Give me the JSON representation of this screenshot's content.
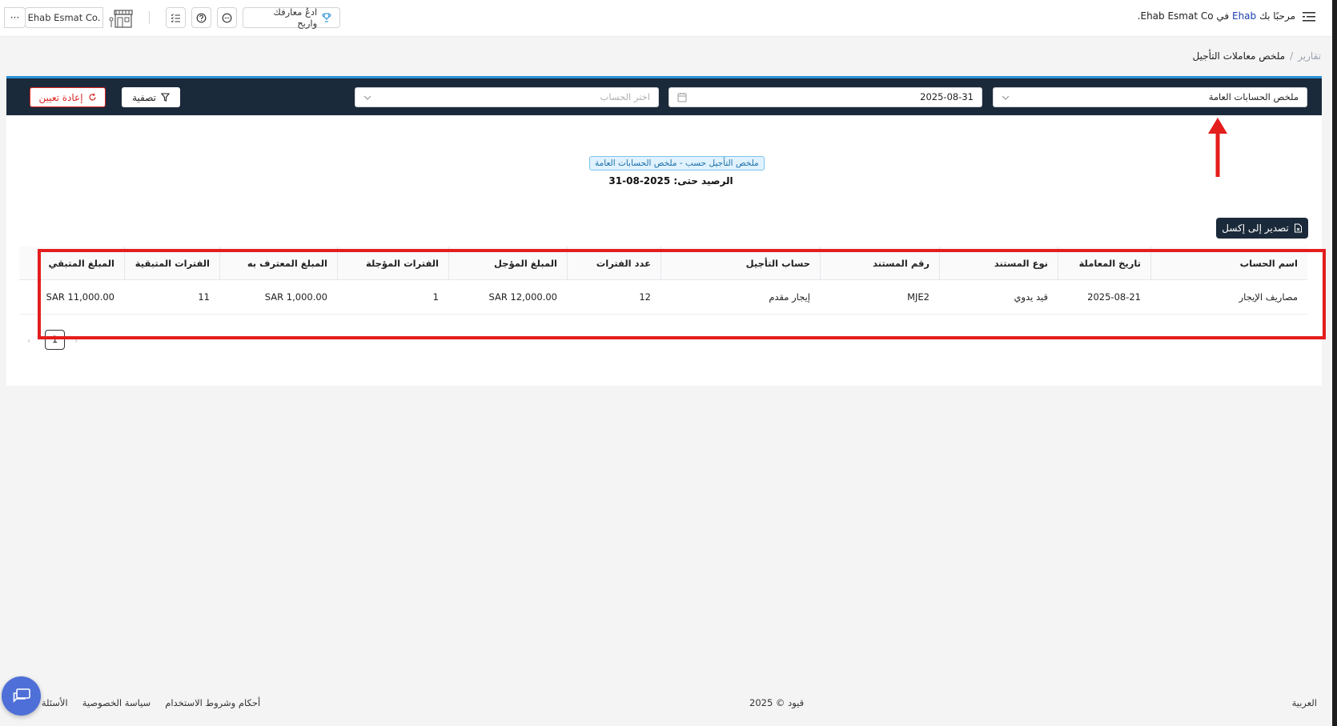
{
  "header": {
    "welcome_prefix": "مرحبًا بك",
    "user_name": "Ehab",
    "welcome_mid": "في",
    "company_name": "Ehab Esmat Co.",
    "learn_button": "ادعُ معارفك واربح",
    "company_switch": "Ehab Esmat Co.",
    "more_label": "···"
  },
  "breadcrumb": {
    "root": "تقارير",
    "separator": "/",
    "current": "ملخص معاملات التأجيل"
  },
  "filters": {
    "report_type": "ملخص الحسابات العامة",
    "date": "2025-08-31",
    "account_placeholder": "اختر الحساب",
    "filter_button": "تصفية",
    "reset_button": "إعادة تعيين"
  },
  "report": {
    "tag": "ملخص التأجيل حسب - ملخص الحسابات العامة",
    "balance_label": "الرصيد حتى:",
    "balance_date": "2025-08-31",
    "export_button": "تصدير إلى إكسل"
  },
  "table": {
    "columns": [
      "اسم الحساب",
      "تاريخ المعاملة",
      "نوع المستند",
      "رقم المستند",
      "حساب التأجيل",
      "عدد الفترات",
      "المبلغ المؤجل",
      "الفترات المؤجلة",
      "المبلغ المعترف به",
      "الفترات المتبقية",
      "المبلغ المتبقي"
    ],
    "rows": [
      [
        "مصاريف الإيجار",
        "2025-08-21",
        "قيد يدوي",
        "MJE2",
        "إيجار مقدم",
        "12",
        "SAR 12,000.00",
        "1",
        "SAR 1,000.00",
        "11",
        "SAR 11,000.00"
      ]
    ]
  },
  "pagination": {
    "current_page": "1",
    "prev": "‹",
    "next": "›"
  },
  "footer": {
    "language": "العربية",
    "copyright": "قيود © 2025",
    "terms": "أحكام وشروط الاستخدام",
    "privacy": "سياسة الخصوصية",
    "faq": "الأسئلة ا"
  },
  "colors": {
    "filter_bar": "#1b2a3a",
    "accent": "#2b8fd6",
    "annotation_red": "#e41d1d",
    "reset_red": "#dc2626",
    "chat_fab": "#4f6fd8"
  },
  "icons": [
    "menu-icon",
    "trophy-icon",
    "chat-bubble-icon",
    "question-icon",
    "checklist-icon",
    "shop-icon",
    "chevron-down-icon",
    "calendar-icon",
    "filter-icon",
    "refresh-icon",
    "excel-file-icon",
    "chat-fab-icon"
  ]
}
